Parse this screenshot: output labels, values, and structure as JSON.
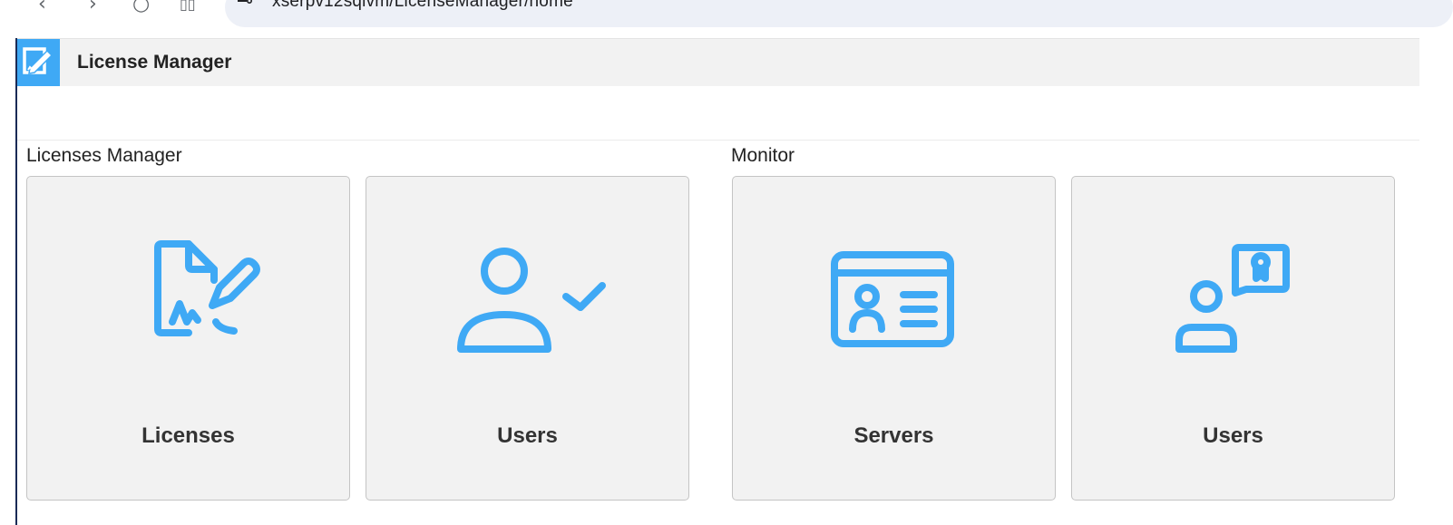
{
  "browser": {
    "url": "xserpv12sqlvm/LicenseManager/home",
    "back_icon": "chevron-left-icon",
    "forward_icon": "chevron-right-icon",
    "reload_icon": "reload-icon",
    "apps_icon": "apps-grid-icon"
  },
  "header": {
    "title": "License Manager",
    "logo_icon": "edit-document-icon",
    "accent_color": "#3fa9f5"
  },
  "sections": [
    {
      "title": "Licenses Manager",
      "tiles": [
        {
          "label": "Licenses",
          "icon": "document-signature-icon"
        },
        {
          "label": "Users",
          "icon": "user-check-icon"
        }
      ]
    },
    {
      "title": "Monitor",
      "tiles": [
        {
          "label": "Servers",
          "icon": "id-card-icon"
        },
        {
          "label": "Users",
          "icon": "user-certificate-icon"
        }
      ]
    }
  ],
  "colors": {
    "icon": "#3fa9f5",
    "tile_background": "#f2f2f2",
    "tile_border": "#c4c4c4"
  }
}
